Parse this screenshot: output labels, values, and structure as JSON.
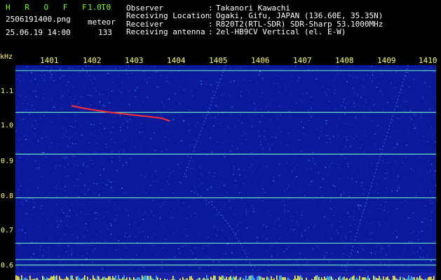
{
  "app": {
    "name": "H R O F F T",
    "version": "1.0.0"
  },
  "file": {
    "name": "2506191400.png",
    "timestamp": "25.06.19 14:00"
  },
  "meteor": {
    "label": "meteor",
    "count": "133"
  },
  "info": [
    {
      "label": "Observer",
      "sep": ":",
      "value": "Takanori Kawachi"
    },
    {
      "label": "Receiving Location",
      "sep": ":",
      "value": "Ogaki, Gifu, JAPAN (136.60E, 35.35N)"
    },
    {
      "label": "Receiver",
      "sep": ":",
      "value": "R820T2(RTL-SDR) SDR-Sharp 53.1000MHz"
    },
    {
      "label": "Receiving antenna",
      "sep": ":",
      "value": "2el-HB9CV Vertical (el. E-W)"
    }
  ],
  "chart_data": {
    "type": "heatmap",
    "ylabel": "kHz",
    "x_ticks": [
      "1401",
      "1402",
      "1403",
      "1404",
      "1405",
      "1406",
      "1407",
      "1408",
      "1409",
      "1410"
    ],
    "y_ticks": [
      "1.1",
      "1.0",
      "0.9",
      "0.8",
      "0.7",
      "0.6"
    ],
    "ylim": [
      0.58,
      1.15
    ],
    "carrier_lines_khz": [
      1.135,
      1.02,
      0.905,
      0.785,
      0.66,
      0.615,
      0.6
    ],
    "colors": {
      "background": "#0b1a9a",
      "line": "#66e0c0",
      "trace": "#ff3030"
    }
  }
}
